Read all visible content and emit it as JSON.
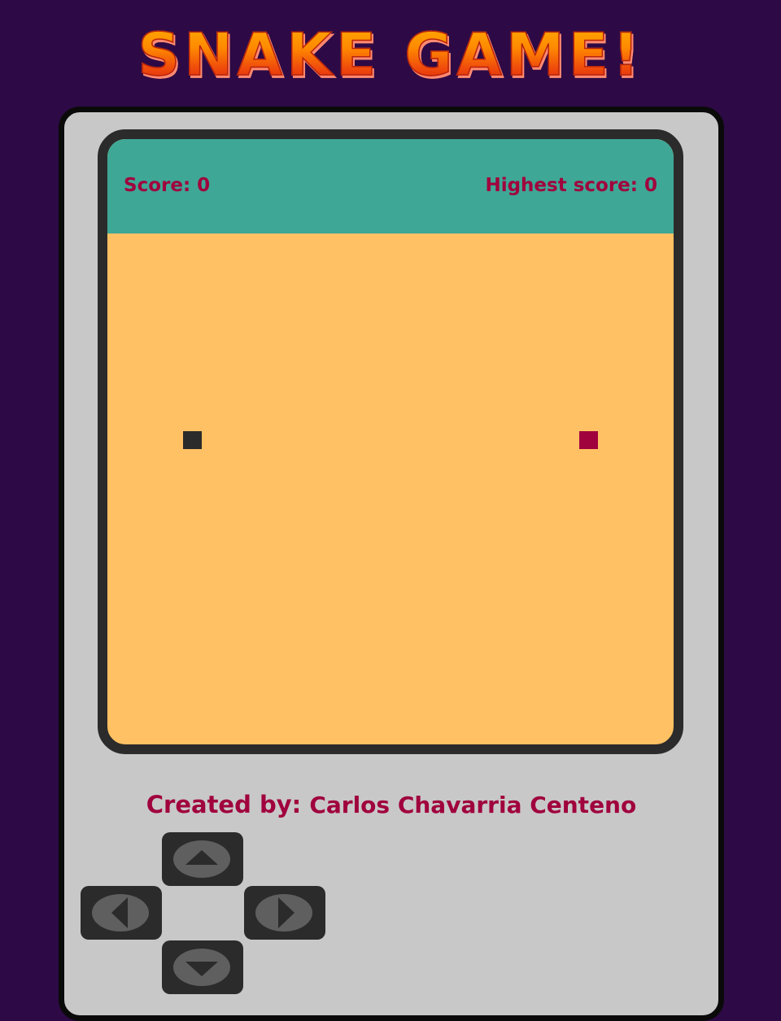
{
  "title": "SNAKE GAME!",
  "scoreboard": {
    "score": "Score: 0",
    "highest": "Highest score: 0"
  },
  "game": {
    "snake_color": "#2b2b2b",
    "food_color": "#a0023d"
  },
  "credits": {
    "label": "Created by:",
    "author": "Carlos Chavarria Centeno"
  },
  "controls": {
    "up": "arrow-up-icon",
    "down": "arrow-down-icon",
    "left": "arrow-left-icon",
    "right": "arrow-right-icon"
  },
  "colors": {
    "background": "#2d0a45",
    "console": "#c8c8c8",
    "scorebar": "#3fa796",
    "board": "#ffc163",
    "accent": "#a0023d"
  }
}
